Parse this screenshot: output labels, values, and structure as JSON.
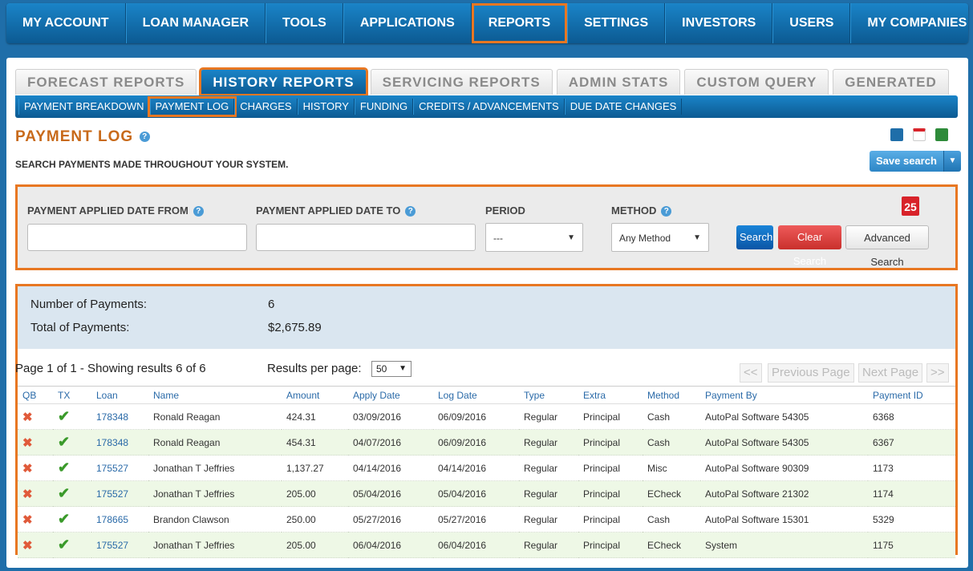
{
  "topnav": [
    "MY ACCOUNT",
    "LOAN MANAGER",
    "TOOLS",
    "APPLICATIONS",
    "REPORTS",
    "SETTINGS",
    "INVESTORS",
    "USERS",
    "MY COMPANIES"
  ],
  "tabs": [
    "FORECAST REPORTS",
    "HISTORY REPORTS",
    "SERVICING REPORTS",
    "ADMIN STATS",
    "CUSTOM QUERY",
    "GENERATED"
  ],
  "subnav": [
    "PAYMENT BREAKDOWN",
    "PAYMENT LOG",
    "CHARGES",
    "HISTORY",
    "FUNDING",
    "CREDITS / ADVANCEMENTS",
    "DUE DATE CHANGES"
  ],
  "page": {
    "title": "PAYMENT LOG",
    "subtitle": "SEARCH PAYMENTS MADE THROUGHOUT YOUR SYSTEM.",
    "save_search": "Save search"
  },
  "search": {
    "from_label": "PAYMENT APPLIED DATE FROM",
    "to_label": "PAYMENT APPLIED DATE TO",
    "period_label": "PERIOD",
    "period_value": "---",
    "method_label": "METHOD",
    "method_value": "Any Method",
    "calendar_day": "25",
    "search_btn": "Search",
    "clear_btn": "Clear Search",
    "adv_btn": "Advanced Search"
  },
  "summary": {
    "count_label": "Number of Payments:",
    "count_value": "6",
    "total_label": "Total of Payments:",
    "total_value": "$2,675.89"
  },
  "pager": {
    "info": "Page 1 of 1 - Showing results 6 of 6",
    "rpp_label": "Results per page:",
    "rpp_value": "50",
    "first": "<<",
    "prev": "Previous Page",
    "next": "Next Page",
    "last": ">>"
  },
  "table": {
    "headers": [
      "QB",
      "TX",
      "Loan",
      "Name",
      "Amount",
      "Apply Date",
      "Log Date",
      "Type",
      "Extra",
      "Method",
      "Payment By",
      "Payment ID"
    ],
    "rows": [
      [
        "178348",
        "Ronald Reagan",
        "424.31",
        "03/09/2016",
        "06/09/2016",
        "Regular",
        "Principal",
        "Cash",
        "AutoPal Software 54305",
        "6368"
      ],
      [
        "178348",
        "Ronald Reagan",
        "454.31",
        "04/07/2016",
        "06/09/2016",
        "Regular",
        "Principal",
        "Cash",
        "AutoPal Software 54305",
        "6367"
      ],
      [
        "175527",
        "Jonathan T Jeffries",
        "1,137.27",
        "04/14/2016",
        "04/14/2016",
        "Regular",
        "Principal",
        "Misc",
        "AutoPal Software 90309",
        "1173"
      ],
      [
        "175527",
        "Jonathan T Jeffries",
        "205.00",
        "05/04/2016",
        "05/04/2016",
        "Regular",
        "Principal",
        "ECheck",
        "AutoPal Software 21302",
        "1174"
      ],
      [
        "178665",
        "Brandon Clawson",
        "250.00",
        "05/27/2016",
        "05/27/2016",
        "Regular",
        "Principal",
        "Cash",
        "AutoPal Software 15301",
        "5329"
      ],
      [
        "175527",
        "Jonathan T Jeffries",
        "205.00",
        "06/04/2016",
        "06/04/2016",
        "Regular",
        "Principal",
        "ECheck",
        "System",
        "1175"
      ]
    ]
  }
}
